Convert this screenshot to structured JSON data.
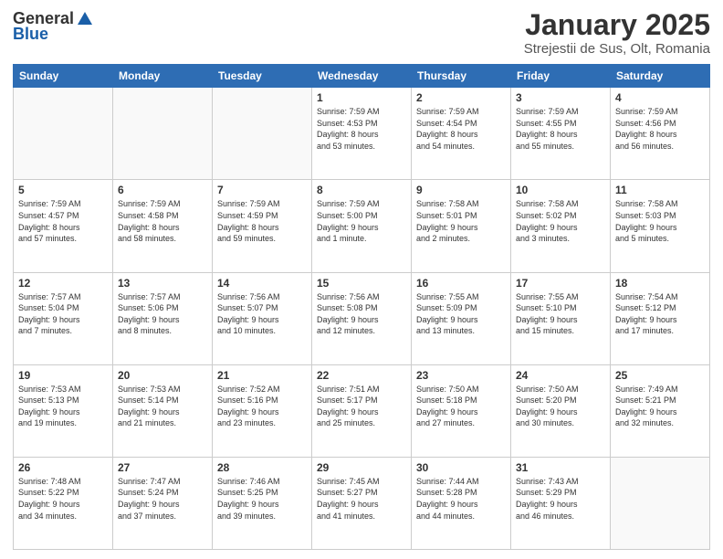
{
  "logo": {
    "general": "General",
    "blue": "Blue"
  },
  "header": {
    "title": "January 2025",
    "subtitle": "Strejestii de Sus, Olt, Romania"
  },
  "weekdays": [
    "Sunday",
    "Monday",
    "Tuesday",
    "Wednesday",
    "Thursday",
    "Friday",
    "Saturday"
  ],
  "weeks": [
    [
      {
        "date": "",
        "info": ""
      },
      {
        "date": "",
        "info": ""
      },
      {
        "date": "",
        "info": ""
      },
      {
        "date": "1",
        "info": "Sunrise: 7:59 AM\nSunset: 4:53 PM\nDaylight: 8 hours\nand 53 minutes."
      },
      {
        "date": "2",
        "info": "Sunrise: 7:59 AM\nSunset: 4:54 PM\nDaylight: 8 hours\nand 54 minutes."
      },
      {
        "date": "3",
        "info": "Sunrise: 7:59 AM\nSunset: 4:55 PM\nDaylight: 8 hours\nand 55 minutes."
      },
      {
        "date": "4",
        "info": "Sunrise: 7:59 AM\nSunset: 4:56 PM\nDaylight: 8 hours\nand 56 minutes."
      }
    ],
    [
      {
        "date": "5",
        "info": "Sunrise: 7:59 AM\nSunset: 4:57 PM\nDaylight: 8 hours\nand 57 minutes."
      },
      {
        "date": "6",
        "info": "Sunrise: 7:59 AM\nSunset: 4:58 PM\nDaylight: 8 hours\nand 58 minutes."
      },
      {
        "date": "7",
        "info": "Sunrise: 7:59 AM\nSunset: 4:59 PM\nDaylight: 8 hours\nand 59 minutes."
      },
      {
        "date": "8",
        "info": "Sunrise: 7:59 AM\nSunset: 5:00 PM\nDaylight: 9 hours\nand 1 minute."
      },
      {
        "date": "9",
        "info": "Sunrise: 7:58 AM\nSunset: 5:01 PM\nDaylight: 9 hours\nand 2 minutes."
      },
      {
        "date": "10",
        "info": "Sunrise: 7:58 AM\nSunset: 5:02 PM\nDaylight: 9 hours\nand 3 minutes."
      },
      {
        "date": "11",
        "info": "Sunrise: 7:58 AM\nSunset: 5:03 PM\nDaylight: 9 hours\nand 5 minutes."
      }
    ],
    [
      {
        "date": "12",
        "info": "Sunrise: 7:57 AM\nSunset: 5:04 PM\nDaylight: 9 hours\nand 7 minutes."
      },
      {
        "date": "13",
        "info": "Sunrise: 7:57 AM\nSunset: 5:06 PM\nDaylight: 9 hours\nand 8 minutes."
      },
      {
        "date": "14",
        "info": "Sunrise: 7:56 AM\nSunset: 5:07 PM\nDaylight: 9 hours\nand 10 minutes."
      },
      {
        "date": "15",
        "info": "Sunrise: 7:56 AM\nSunset: 5:08 PM\nDaylight: 9 hours\nand 12 minutes."
      },
      {
        "date": "16",
        "info": "Sunrise: 7:55 AM\nSunset: 5:09 PM\nDaylight: 9 hours\nand 13 minutes."
      },
      {
        "date": "17",
        "info": "Sunrise: 7:55 AM\nSunset: 5:10 PM\nDaylight: 9 hours\nand 15 minutes."
      },
      {
        "date": "18",
        "info": "Sunrise: 7:54 AM\nSunset: 5:12 PM\nDaylight: 9 hours\nand 17 minutes."
      }
    ],
    [
      {
        "date": "19",
        "info": "Sunrise: 7:53 AM\nSunset: 5:13 PM\nDaylight: 9 hours\nand 19 minutes."
      },
      {
        "date": "20",
        "info": "Sunrise: 7:53 AM\nSunset: 5:14 PM\nDaylight: 9 hours\nand 21 minutes."
      },
      {
        "date": "21",
        "info": "Sunrise: 7:52 AM\nSunset: 5:16 PM\nDaylight: 9 hours\nand 23 minutes."
      },
      {
        "date": "22",
        "info": "Sunrise: 7:51 AM\nSunset: 5:17 PM\nDaylight: 9 hours\nand 25 minutes."
      },
      {
        "date": "23",
        "info": "Sunrise: 7:50 AM\nSunset: 5:18 PM\nDaylight: 9 hours\nand 27 minutes."
      },
      {
        "date": "24",
        "info": "Sunrise: 7:50 AM\nSunset: 5:20 PM\nDaylight: 9 hours\nand 30 minutes."
      },
      {
        "date": "25",
        "info": "Sunrise: 7:49 AM\nSunset: 5:21 PM\nDaylight: 9 hours\nand 32 minutes."
      }
    ],
    [
      {
        "date": "26",
        "info": "Sunrise: 7:48 AM\nSunset: 5:22 PM\nDaylight: 9 hours\nand 34 minutes."
      },
      {
        "date": "27",
        "info": "Sunrise: 7:47 AM\nSunset: 5:24 PM\nDaylight: 9 hours\nand 37 minutes."
      },
      {
        "date": "28",
        "info": "Sunrise: 7:46 AM\nSunset: 5:25 PM\nDaylight: 9 hours\nand 39 minutes."
      },
      {
        "date": "29",
        "info": "Sunrise: 7:45 AM\nSunset: 5:27 PM\nDaylight: 9 hours\nand 41 minutes."
      },
      {
        "date": "30",
        "info": "Sunrise: 7:44 AM\nSunset: 5:28 PM\nDaylight: 9 hours\nand 44 minutes."
      },
      {
        "date": "31",
        "info": "Sunrise: 7:43 AM\nSunset: 5:29 PM\nDaylight: 9 hours\nand 46 minutes."
      },
      {
        "date": "",
        "info": ""
      }
    ]
  ]
}
